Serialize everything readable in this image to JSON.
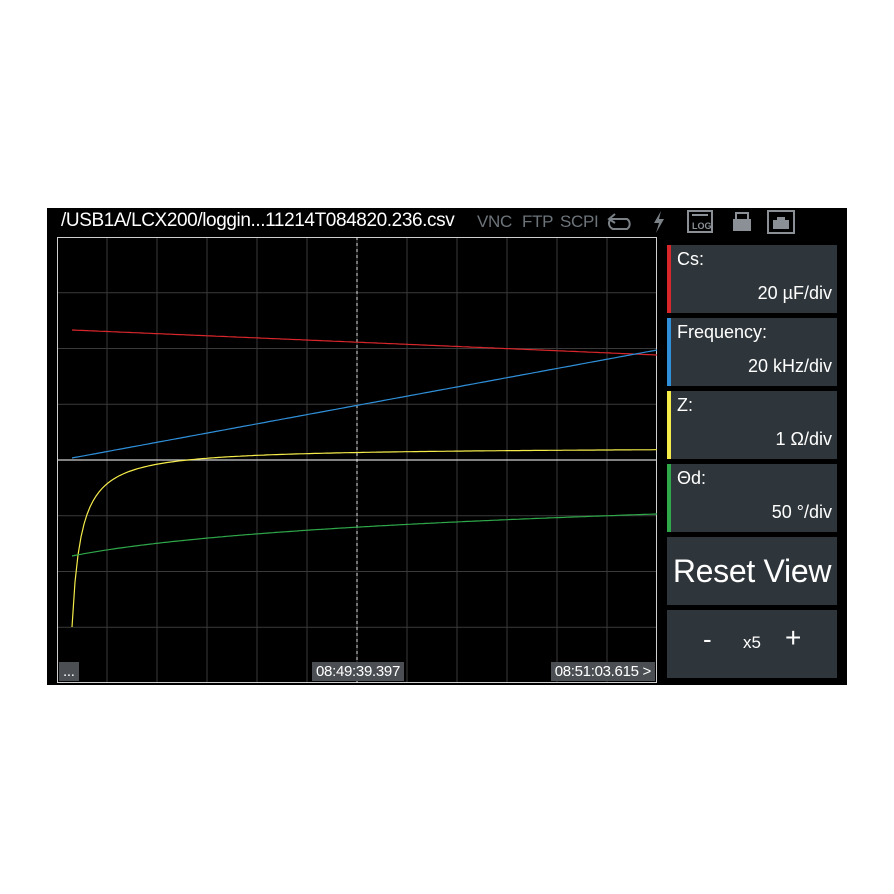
{
  "titlebar": {
    "path": "/USB1A/LCX200/loggin...11214T084820.236.csv",
    "status": {
      "vnc": "VNC",
      "ftp": "FTP",
      "scpi": "SCPI"
    },
    "icons": [
      "refresh-icon",
      "lightning-icon",
      "log-icon",
      "usb-drive-icon",
      "ethernet-icon"
    ]
  },
  "plot": {
    "colors": {
      "cs": "#d9262b",
      "frequency": "#2f8fd8",
      "z": "#f5ec4a",
      "theta": "#2fa84a",
      "grid": "#3a3a3a",
      "axis": "#cfcfcf"
    },
    "menu_label": "...",
    "cursor_time": "08:49:39.397",
    "end_time": "08:51:03.615 >"
  },
  "traces": [
    {
      "name": "Cs",
      "color": "#d9262b"
    },
    {
      "name": "Frequency",
      "color": "#2f8fd8"
    },
    {
      "name": "Z",
      "color": "#f5ec4a"
    },
    {
      "name": "Θd",
      "color": "#2fa84a"
    }
  ],
  "side": {
    "tiles": [
      {
        "label": "Cs:",
        "value": "20 µF/div",
        "color": "#d9262b"
      },
      {
        "label": "Frequency:",
        "value": "20 kHz/div",
        "color": "#2f8fd8"
      },
      {
        "label": "Z:",
        "value": "1 Ω/div",
        "color": "#f5ec4a"
      },
      {
        "label": "Θd:",
        "value": "50 °/div",
        "color": "#2fa84a"
      }
    ],
    "reset_label": "Reset View",
    "zoom": {
      "minus": "-",
      "factor": "x5",
      "plus": "+"
    }
  }
}
